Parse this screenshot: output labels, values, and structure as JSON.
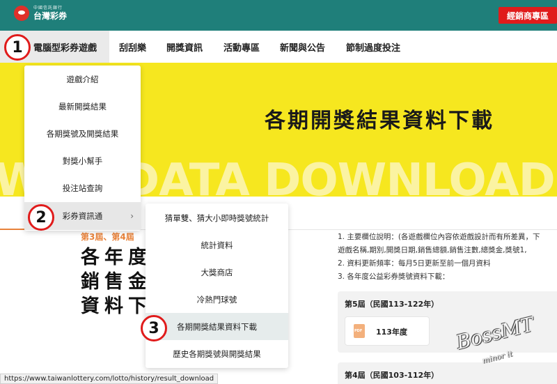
{
  "brand": {
    "small": "中國信託銀行",
    "name": "台灣彩券",
    "accent": "#1f7f7a"
  },
  "header": {
    "dealer_button": "經銷商專區"
  },
  "nav": {
    "items": [
      "電腦型彩券遊戲",
      "刮刮樂",
      "開獎資訊",
      "活動專區",
      "新聞與公告",
      "節制過度投注"
    ]
  },
  "hero": {
    "title": "各期開獎結果資料下載",
    "bg_text": "W  LT DATA DOWNLOAD D"
  },
  "dropdown": {
    "items": [
      "遊戲介紹",
      "最新開獎結果",
      "各期獎號及開獎結果",
      "對獎小幫手",
      "投注站查詢",
      "彩券資訊通"
    ]
  },
  "submenu": {
    "items": [
      "猜單雙、猜大小即時獎號統計",
      "統計資料",
      "大獎商店",
      "冷熱門球號",
      "各期開獎結果資料下載",
      "歷史各期獎號與開獎結果"
    ]
  },
  "content": {
    "orange_sub": "第3屆、第4屆",
    "big_lines": [
      "各年度",
      "銷售金",
      "資料下"
    ],
    "info_lines": [
      "1. 主要欄位說明：(各遊戲欄位內容依遊戲設計而有所差異，下",
      "    遊戲名稱,期別,開獎日期,銷售總額,銷售注數,總獎金,獎號1,",
      "2. 資料更新頻率：每月5日更新至前一個月資料",
      "3. 各年度公益彩券獎號資料下載："
    ],
    "periods": [
      {
        "title": "第5屆（民國113-122年）",
        "year": "113年度"
      },
      {
        "title": "第4屆（民國103-112年）"
      }
    ]
  },
  "steps": [
    "1",
    "2",
    "3"
  ],
  "statusbar": {
    "url": "https://www.taiwanlottery.com/lotto/history/result_download"
  },
  "watermark": {
    "main": "BossMT",
    "sub": "minor it"
  }
}
